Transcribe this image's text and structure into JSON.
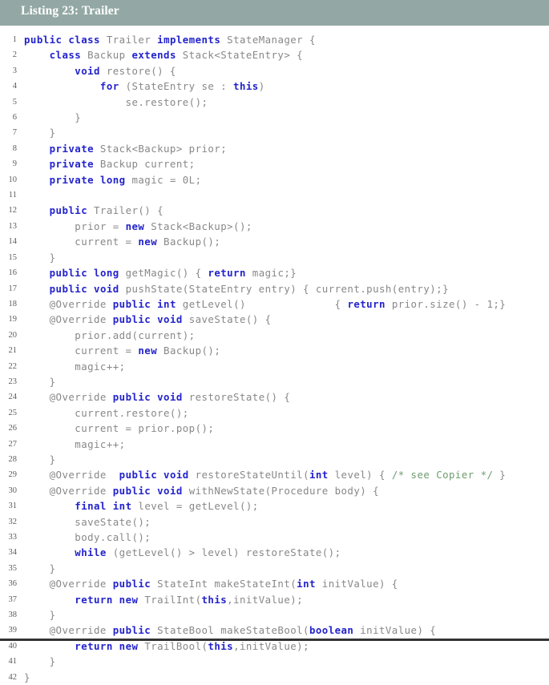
{
  "caption": {
    "label": "Listing 23: Trailer"
  },
  "colors": {
    "caption_bar": "#93a8a4",
    "caption_text": "#ffffff",
    "code_text": "#888888",
    "keyword": "#2323cc",
    "comment": "#6f9d6f",
    "page_background": "#ffffff",
    "bottom_rule": "#333333"
  },
  "code": {
    "language": "java",
    "first_line_number": 1,
    "last_line_number": 42,
    "lines": [
      {
        "n": "1",
        "tokens": [
          {
            "t": "k",
            "v": "public"
          },
          {
            "t": "p",
            "v": " "
          },
          {
            "t": "k",
            "v": "class"
          },
          {
            "t": "p",
            "v": " Trailer "
          },
          {
            "t": "k",
            "v": "implements"
          },
          {
            "t": "p",
            "v": " StateManager {"
          }
        ]
      },
      {
        "n": "2",
        "tokens": [
          {
            "t": "p",
            "v": "    "
          },
          {
            "t": "k",
            "v": "class"
          },
          {
            "t": "p",
            "v": " Backup "
          },
          {
            "t": "k",
            "v": "extends"
          },
          {
            "t": "p",
            "v": " Stack<StateEntry> {"
          }
        ]
      },
      {
        "n": "3",
        "tokens": [
          {
            "t": "p",
            "v": "        "
          },
          {
            "t": "k",
            "v": "void"
          },
          {
            "t": "p",
            "v": " restore() {"
          }
        ]
      },
      {
        "n": "4",
        "tokens": [
          {
            "t": "p",
            "v": "            "
          },
          {
            "t": "k",
            "v": "for"
          },
          {
            "t": "p",
            "v": " (StateEntry se : "
          },
          {
            "t": "k",
            "v": "this"
          },
          {
            "t": "p",
            "v": ")"
          }
        ]
      },
      {
        "n": "5",
        "tokens": [
          {
            "t": "p",
            "v": "                se.restore();"
          }
        ]
      },
      {
        "n": "6",
        "tokens": [
          {
            "t": "p",
            "v": "        }"
          }
        ]
      },
      {
        "n": "7",
        "tokens": [
          {
            "t": "p",
            "v": "    }"
          }
        ]
      },
      {
        "n": "8",
        "tokens": [
          {
            "t": "p",
            "v": "    "
          },
          {
            "t": "k",
            "v": "private"
          },
          {
            "t": "p",
            "v": " Stack<Backup> prior;"
          }
        ]
      },
      {
        "n": "9",
        "tokens": [
          {
            "t": "p",
            "v": "    "
          },
          {
            "t": "k",
            "v": "private"
          },
          {
            "t": "p",
            "v": " Backup current;"
          }
        ]
      },
      {
        "n": "10",
        "tokens": [
          {
            "t": "p",
            "v": "    "
          },
          {
            "t": "k",
            "v": "private"
          },
          {
            "t": "p",
            "v": " "
          },
          {
            "t": "k",
            "v": "long"
          },
          {
            "t": "p",
            "v": " magic = 0L;"
          }
        ]
      },
      {
        "n": "11",
        "tokens": [
          {
            "t": "p",
            "v": ""
          }
        ]
      },
      {
        "n": "12",
        "tokens": [
          {
            "t": "p",
            "v": "    "
          },
          {
            "t": "k",
            "v": "public"
          },
          {
            "t": "p",
            "v": " Trailer() {"
          }
        ]
      },
      {
        "n": "13",
        "tokens": [
          {
            "t": "p",
            "v": "        prior = "
          },
          {
            "t": "k",
            "v": "new"
          },
          {
            "t": "p",
            "v": " Stack<Backup>();"
          }
        ]
      },
      {
        "n": "14",
        "tokens": [
          {
            "t": "p",
            "v": "        current = "
          },
          {
            "t": "k",
            "v": "new"
          },
          {
            "t": "p",
            "v": " Backup();"
          }
        ]
      },
      {
        "n": "15",
        "tokens": [
          {
            "t": "p",
            "v": "    }"
          }
        ]
      },
      {
        "n": "16",
        "tokens": [
          {
            "t": "p",
            "v": "    "
          },
          {
            "t": "k",
            "v": "public"
          },
          {
            "t": "p",
            "v": " "
          },
          {
            "t": "k",
            "v": "long"
          },
          {
            "t": "p",
            "v": " getMagic() { "
          },
          {
            "t": "k",
            "v": "return"
          },
          {
            "t": "p",
            "v": " magic;}"
          }
        ]
      },
      {
        "n": "17",
        "tokens": [
          {
            "t": "p",
            "v": "    "
          },
          {
            "t": "k",
            "v": "public"
          },
          {
            "t": "p",
            "v": " "
          },
          {
            "t": "k",
            "v": "void"
          },
          {
            "t": "p",
            "v": " pushState(StateEntry entry) { current.push(entry);}"
          }
        ]
      },
      {
        "n": "18",
        "tokens": [
          {
            "t": "p",
            "v": "    @Override "
          },
          {
            "t": "k",
            "v": "public"
          },
          {
            "t": "p",
            "v": " "
          },
          {
            "t": "k",
            "v": "int"
          },
          {
            "t": "p",
            "v": " getLevel()              { "
          },
          {
            "t": "k",
            "v": "return"
          },
          {
            "t": "p",
            "v": " prior.size() - 1;}"
          }
        ]
      },
      {
        "n": "19",
        "tokens": [
          {
            "t": "p",
            "v": "    @Override "
          },
          {
            "t": "k",
            "v": "public"
          },
          {
            "t": "p",
            "v": " "
          },
          {
            "t": "k",
            "v": "void"
          },
          {
            "t": "p",
            "v": " saveState() {"
          }
        ]
      },
      {
        "n": "20",
        "tokens": [
          {
            "t": "p",
            "v": "        prior.add(current);"
          }
        ]
      },
      {
        "n": "21",
        "tokens": [
          {
            "t": "p",
            "v": "        current = "
          },
          {
            "t": "k",
            "v": "new"
          },
          {
            "t": "p",
            "v": " Backup();"
          }
        ]
      },
      {
        "n": "22",
        "tokens": [
          {
            "t": "p",
            "v": "        magic++;"
          }
        ]
      },
      {
        "n": "23",
        "tokens": [
          {
            "t": "p",
            "v": "    }"
          }
        ]
      },
      {
        "n": "24",
        "tokens": [
          {
            "t": "p",
            "v": "    @Override "
          },
          {
            "t": "k",
            "v": "public"
          },
          {
            "t": "p",
            "v": " "
          },
          {
            "t": "k",
            "v": "void"
          },
          {
            "t": "p",
            "v": " restoreState() {"
          }
        ]
      },
      {
        "n": "25",
        "tokens": [
          {
            "t": "p",
            "v": "        current.restore();"
          }
        ]
      },
      {
        "n": "26",
        "tokens": [
          {
            "t": "p",
            "v": "        current = prior.pop();"
          }
        ]
      },
      {
        "n": "27",
        "tokens": [
          {
            "t": "p",
            "v": "        magic++;"
          }
        ]
      },
      {
        "n": "28",
        "tokens": [
          {
            "t": "p",
            "v": "    }"
          }
        ]
      },
      {
        "n": "29",
        "tokens": [
          {
            "t": "p",
            "v": "    @Override  "
          },
          {
            "t": "k",
            "v": "public"
          },
          {
            "t": "p",
            "v": " "
          },
          {
            "t": "k",
            "v": "void"
          },
          {
            "t": "p",
            "v": " restoreStateUntil("
          },
          {
            "t": "k",
            "v": "int"
          },
          {
            "t": "p",
            "v": " level) { "
          },
          {
            "t": "c",
            "v": "/* see Copier */"
          },
          {
            "t": "p",
            "v": " }"
          }
        ]
      },
      {
        "n": "30",
        "tokens": [
          {
            "t": "p",
            "v": "    @Override "
          },
          {
            "t": "k",
            "v": "public"
          },
          {
            "t": "p",
            "v": " "
          },
          {
            "t": "k",
            "v": "void"
          },
          {
            "t": "p",
            "v": " withNewState(Procedure body) {"
          }
        ]
      },
      {
        "n": "31",
        "tokens": [
          {
            "t": "p",
            "v": "        "
          },
          {
            "t": "k",
            "v": "final"
          },
          {
            "t": "p",
            "v": " "
          },
          {
            "t": "k",
            "v": "int"
          },
          {
            "t": "p",
            "v": " level = getLevel();"
          }
        ]
      },
      {
        "n": "32",
        "tokens": [
          {
            "t": "p",
            "v": "        saveState();"
          }
        ]
      },
      {
        "n": "33",
        "tokens": [
          {
            "t": "p",
            "v": "        body.call();"
          }
        ]
      },
      {
        "n": "34",
        "tokens": [
          {
            "t": "p",
            "v": "        "
          },
          {
            "t": "k",
            "v": "while"
          },
          {
            "t": "p",
            "v": " (getLevel() > level) restoreState();"
          }
        ]
      },
      {
        "n": "35",
        "tokens": [
          {
            "t": "p",
            "v": "    }"
          }
        ]
      },
      {
        "n": "36",
        "tokens": [
          {
            "t": "p",
            "v": "    @Override "
          },
          {
            "t": "k",
            "v": "public"
          },
          {
            "t": "p",
            "v": " StateInt makeStateInt("
          },
          {
            "t": "k",
            "v": "int"
          },
          {
            "t": "p",
            "v": " initValue) {"
          }
        ]
      },
      {
        "n": "37",
        "tokens": [
          {
            "t": "p",
            "v": "        "
          },
          {
            "t": "k",
            "v": "return"
          },
          {
            "t": "p",
            "v": " "
          },
          {
            "t": "k",
            "v": "new"
          },
          {
            "t": "p",
            "v": " TrailInt("
          },
          {
            "t": "k",
            "v": "this"
          },
          {
            "t": "p",
            "v": ",initValue);"
          }
        ]
      },
      {
        "n": "38",
        "tokens": [
          {
            "t": "p",
            "v": "    }"
          }
        ]
      },
      {
        "n": "39",
        "tokens": [
          {
            "t": "p",
            "v": "    @Override "
          },
          {
            "t": "k",
            "v": "public"
          },
          {
            "t": "p",
            "v": " StateBool makeStateBool("
          },
          {
            "t": "k",
            "v": "boolean"
          },
          {
            "t": "p",
            "v": " initValue) {"
          }
        ]
      },
      {
        "n": "40",
        "tokens": [
          {
            "t": "p",
            "v": "        "
          },
          {
            "t": "k",
            "v": "return"
          },
          {
            "t": "p",
            "v": " "
          },
          {
            "t": "k",
            "v": "new"
          },
          {
            "t": "p",
            "v": " TrailBool("
          },
          {
            "t": "k",
            "v": "this"
          },
          {
            "t": "p",
            "v": ",initValue);"
          }
        ]
      },
      {
        "n": "41",
        "tokens": [
          {
            "t": "p",
            "v": "    }"
          }
        ]
      },
      {
        "n": "42",
        "tokens": [
          {
            "t": "p",
            "v": "}"
          }
        ]
      }
    ]
  }
}
